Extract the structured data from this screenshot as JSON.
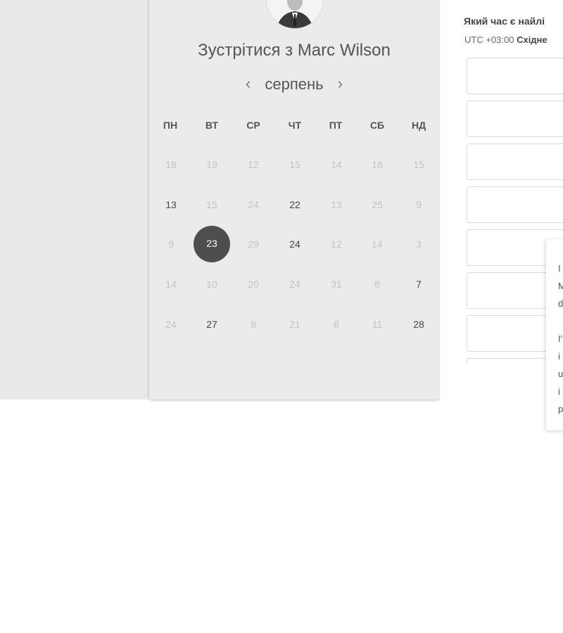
{
  "header": {
    "title_prefix": "Зустрітися з",
    "title_name": "Marc Wilson"
  },
  "calendar": {
    "month": "серпень",
    "prev_icon": "‹",
    "next_icon": "›",
    "weekdays": [
      "ПН",
      "ВТ",
      "СР",
      "ЧТ",
      "ПТ",
      "СБ",
      "НД"
    ],
    "weeks": [
      [
        {
          "d": "18",
          "s": "disabled"
        },
        {
          "d": "19",
          "s": "disabled"
        },
        {
          "d": "12",
          "s": "disabled"
        },
        {
          "d": "15",
          "s": "disabled"
        },
        {
          "d": "14",
          "s": "disabled"
        },
        {
          "d": "16",
          "s": "disabled"
        },
        {
          "d": "15",
          "s": "disabled"
        }
      ],
      [
        {
          "d": "13",
          "s": "enabled"
        },
        {
          "d": "15",
          "s": "disabled"
        },
        {
          "d": "24",
          "s": "disabled"
        },
        {
          "d": "22",
          "s": "enabled"
        },
        {
          "d": "13",
          "s": "disabled"
        },
        {
          "d": "25",
          "s": "disabled"
        },
        {
          "d": "9",
          "s": "disabled"
        }
      ],
      [
        {
          "d": "9",
          "s": "disabled"
        },
        {
          "d": "23",
          "s": "selected"
        },
        {
          "d": "29",
          "s": "disabled"
        },
        {
          "d": "24",
          "s": "enabled"
        },
        {
          "d": "12",
          "s": "disabled"
        },
        {
          "d": "14",
          "s": "disabled"
        },
        {
          "d": "3",
          "s": "disabled"
        }
      ],
      [
        {
          "d": "14",
          "s": "disabled"
        },
        {
          "d": "10",
          "s": "disabled"
        },
        {
          "d": "20",
          "s": "disabled"
        },
        {
          "d": "24",
          "s": "disabled"
        },
        {
          "d": "31",
          "s": "disabled"
        },
        {
          "d": "8",
          "s": "disabled"
        },
        {
          "d": "7",
          "s": "enabled"
        }
      ],
      [
        {
          "d": "24",
          "s": "disabled"
        },
        {
          "d": "27",
          "s": "enabled"
        },
        {
          "d": "8",
          "s": "disabled"
        },
        {
          "d": "21",
          "s": "disabled"
        },
        {
          "d": "8",
          "s": "disabled"
        },
        {
          "d": "11",
          "s": "disabled"
        },
        {
          "d": "28",
          "s": "enabled"
        }
      ]
    ]
  },
  "timezone": {
    "question": "Який час є найлі",
    "offset": "UTC +03:00",
    "name": "Східне"
  },
  "time_slots": {
    "count": 8
  },
  "popover": {
    "lines": [
      "I",
      "M",
      "d",
      "",
      "I'",
      "i",
      "u",
      "i",
      "p"
    ]
  }
}
